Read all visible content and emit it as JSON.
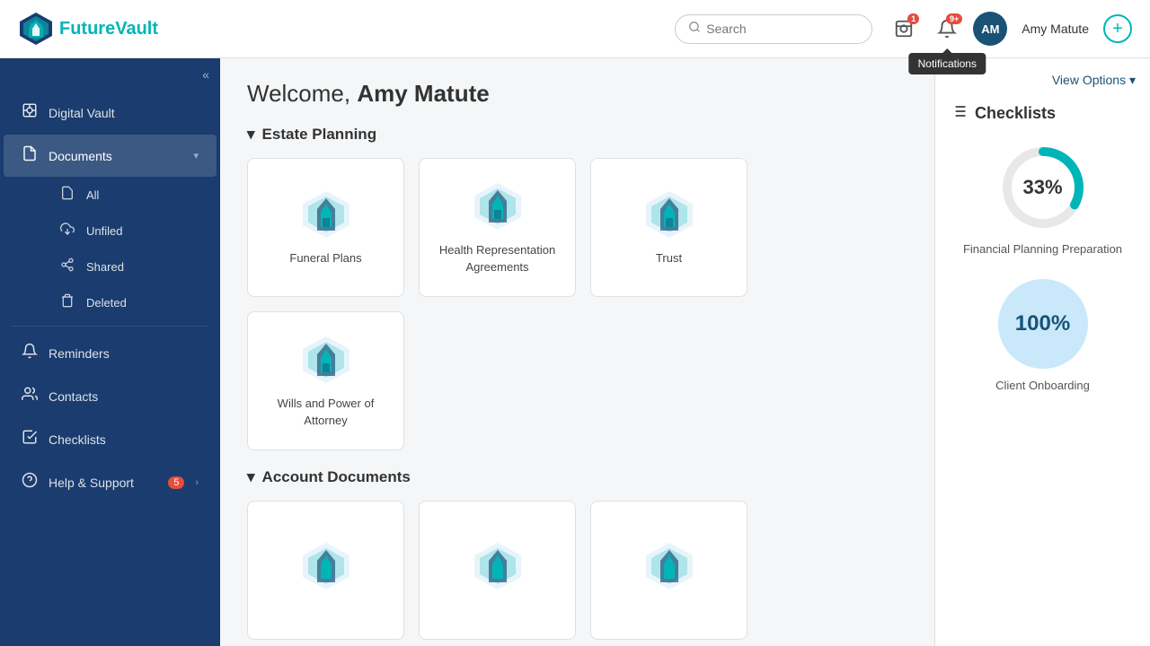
{
  "app": {
    "name": "FutureVault",
    "name_part1": "Future",
    "name_part2": "Vault"
  },
  "topbar": {
    "search_placeholder": "Search",
    "notifications_label": "Notifications",
    "notifications_badge": "9+",
    "vault_badge": "1",
    "user_initials": "AM",
    "user_name": "Amy Matute",
    "add_button_label": "+"
  },
  "sidebar": {
    "collapse_icon": "«",
    "items": [
      {
        "id": "digital-vault",
        "label": "Digital Vault",
        "icon": "🏛"
      },
      {
        "id": "documents",
        "label": "Documents",
        "icon": "📄",
        "active": true,
        "has_caret": true
      },
      {
        "id": "all",
        "label": "All",
        "icon": "📋",
        "sub": true
      },
      {
        "id": "unfiled",
        "label": "Unfiled",
        "icon": "📤",
        "sub": true
      },
      {
        "id": "shared",
        "label": "Shared",
        "icon": "🔗",
        "sub": true
      },
      {
        "id": "deleted",
        "label": "Deleted",
        "icon": "🗑",
        "sub": true
      },
      {
        "id": "reminders",
        "label": "Reminders",
        "icon": "🔔"
      },
      {
        "id": "contacts",
        "label": "Contacts",
        "icon": "👥"
      },
      {
        "id": "checklists",
        "label": "Checklists",
        "icon": "✅"
      },
      {
        "id": "help",
        "label": "Help & Support",
        "icon": "❓",
        "badge": "5",
        "has_caret": true
      }
    ]
  },
  "main": {
    "welcome_text": "Welcome, ",
    "user_name": "Amy Matute",
    "view_options_label": "View Options",
    "sections": [
      {
        "id": "estate-planning",
        "title": "Estate Planning",
        "cards": [
          {
            "id": "funeral-plans",
            "label": "Funeral Plans"
          },
          {
            "id": "health-representation",
            "label": "Health Representation Agreements"
          },
          {
            "id": "trust",
            "label": "Trust"
          },
          {
            "id": "wills-poa",
            "label": "Wills and Power of Attorney"
          }
        ]
      },
      {
        "id": "account-documents",
        "title": "Account Documents",
        "cards": [
          {
            "id": "card4",
            "label": ""
          },
          {
            "id": "card5",
            "label": ""
          },
          {
            "id": "card6",
            "label": ""
          }
        ]
      }
    ]
  },
  "right_panel": {
    "view_options_label": "View Options ▾",
    "checklists_label": "Checklists",
    "items": [
      {
        "id": "financial-planning",
        "percent": "33%",
        "label": "Financial Planning Preparation",
        "type": "arc"
      },
      {
        "id": "client-onboarding",
        "percent": "100%",
        "label": "Client Onboarding",
        "type": "full"
      }
    ]
  }
}
